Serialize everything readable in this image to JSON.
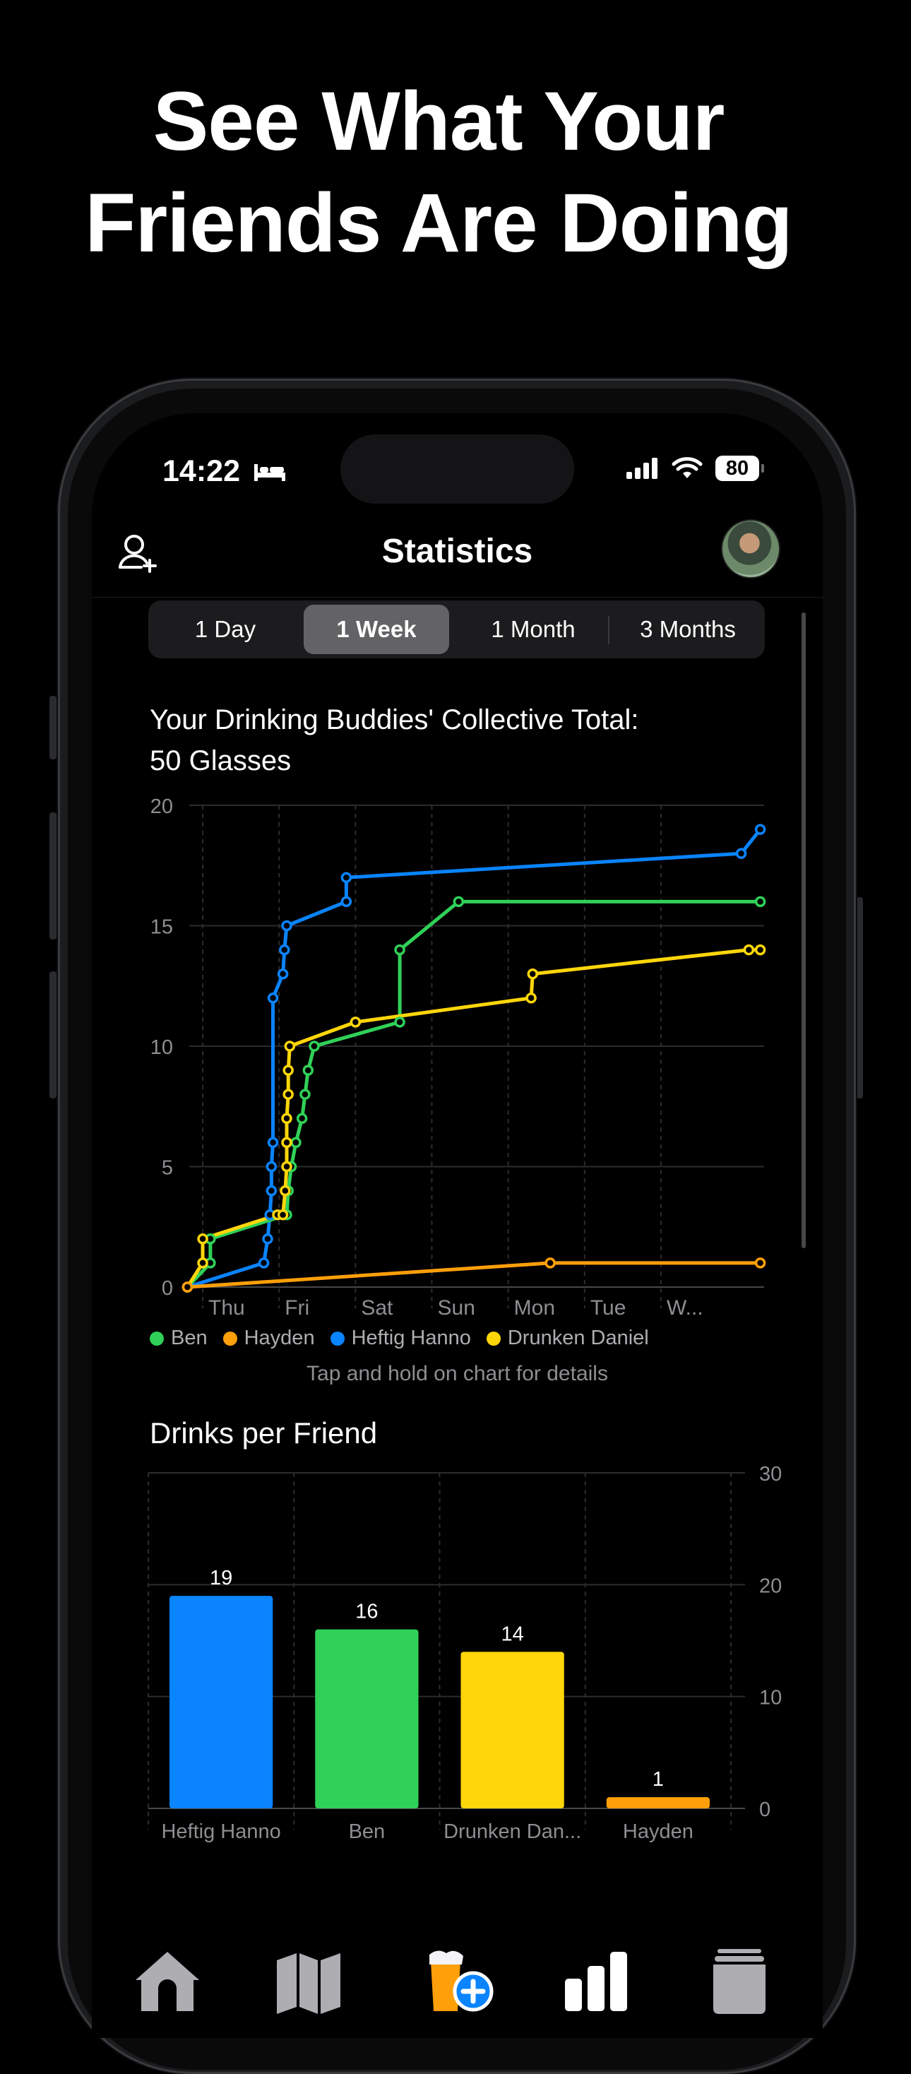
{
  "headline": {
    "line1": "See What Your",
    "line2": "Friends Are Doing"
  },
  "status_bar": {
    "time": "14:22",
    "battery": "80"
  },
  "nav": {
    "title": "Statistics"
  },
  "segments": [
    {
      "label": "1 Day",
      "active": false
    },
    {
      "label": "1 Week",
      "active": true
    },
    {
      "label": "1 Month",
      "active": false
    },
    {
      "label": "3 Months",
      "active": false
    }
  ],
  "line_chart": {
    "title_line1": "Your Drinking Buddies' Collective Total:",
    "title_line2": "50 Glasses",
    "hint": "Tap and hold on chart for details"
  },
  "bar_chart": {
    "title": "Drinks per Friend"
  },
  "legend": [
    {
      "name": "Ben",
      "color": "#30d158"
    },
    {
      "name": "Hayden",
      "color": "#ff9f0a"
    },
    {
      "name": "Heftig Hanno",
      "color": "#0a84ff"
    },
    {
      "name": "Drunken Daniel",
      "color": "#ffd60a"
    }
  ],
  "chart_data": [
    {
      "type": "line",
      "title": "Your Drinking Buddies' Collective Total: 50 Glasses",
      "xlabel": "",
      "ylabel": "",
      "x_ticks": [
        "Thu",
        "Fri",
        "Sat",
        "Sun",
        "Mon",
        "Tue",
        "W..."
      ],
      "ylim": [
        0,
        20
      ],
      "y_ticks": [
        0,
        5,
        10,
        15,
        20
      ],
      "grid": true,
      "legend_position": "bottom",
      "series": [
        {
          "name": "Heftig Hanno",
          "color": "#0a84ff",
          "points": [
            [
              -0.7,
              0
            ],
            [
              0.3,
              1
            ],
            [
              0.35,
              2
            ],
            [
              0.38,
              3
            ],
            [
              0.4,
              4
            ],
            [
              0.4,
              5
            ],
            [
              0.42,
              6
            ],
            [
              0.42,
              12
            ],
            [
              0.55,
              13
            ],
            [
              0.57,
              14
            ],
            [
              0.6,
              15
            ],
            [
              1.38,
              16
            ],
            [
              1.38,
              17
            ],
            [
              6.55,
              18
            ],
            [
              6.8,
              19
            ]
          ]
        },
        {
          "name": "Ben",
          "color": "#30d158",
          "points": [
            [
              -0.7,
              0
            ],
            [
              -0.4,
              1
            ],
            [
              -0.4,
              2
            ],
            [
              0.6,
              3
            ],
            [
              0.62,
              4
            ],
            [
              0.66,
              5
            ],
            [
              0.72,
              6
            ],
            [
              0.8,
              7
            ],
            [
              0.84,
              8
            ],
            [
              0.88,
              9
            ],
            [
              0.96,
              10
            ],
            [
              2.08,
              11
            ],
            [
              2.08,
              14
            ],
            [
              2.85,
              16
            ],
            [
              6.8,
              16
            ]
          ]
        },
        {
          "name": "Drunken Daniel",
          "color": "#ffd60a",
          "points": [
            [
              -0.7,
              0
            ],
            [
              -0.5,
              1
            ],
            [
              -0.5,
              2
            ],
            [
              0.48,
              3
            ],
            [
              0.55,
              3
            ],
            [
              0.58,
              4
            ],
            [
              0.6,
              5
            ],
            [
              0.6,
              6
            ],
            [
              0.6,
              7
            ],
            [
              0.62,
              8
            ],
            [
              0.62,
              9
            ],
            [
              0.64,
              10
            ],
            [
              1.5,
              11
            ],
            [
              3.8,
              12
            ],
            [
              3.82,
              13
            ],
            [
              6.65,
              14
            ],
            [
              6.8,
              14
            ]
          ]
        },
        {
          "name": "Hayden",
          "color": "#ff9f0a",
          "points": [
            [
              -0.7,
              0
            ],
            [
              4.05,
              1
            ],
            [
              6.8,
              1
            ]
          ]
        }
      ]
    },
    {
      "type": "bar",
      "title": "Drinks per Friend",
      "xlabel": "",
      "ylabel": "",
      "categories": [
        "Heftig Hanno",
        "Ben",
        "Drunken Dan...",
        "Hayden"
      ],
      "values": [
        19,
        16,
        14,
        1
      ],
      "colors": [
        "#0a84ff",
        "#30d158",
        "#ffd60a",
        "#ff9f0a"
      ],
      "ylim": [
        0,
        30
      ],
      "y_ticks": [
        0,
        10,
        20,
        30
      ],
      "y_axis_position": "right",
      "grid": true
    }
  ],
  "tabs": [
    {
      "icon": "house-icon"
    },
    {
      "icon": "map-icon"
    },
    {
      "icon": "beer-add-icon"
    },
    {
      "icon": "bar-chart-icon"
    },
    {
      "icon": "glass-icon"
    }
  ]
}
